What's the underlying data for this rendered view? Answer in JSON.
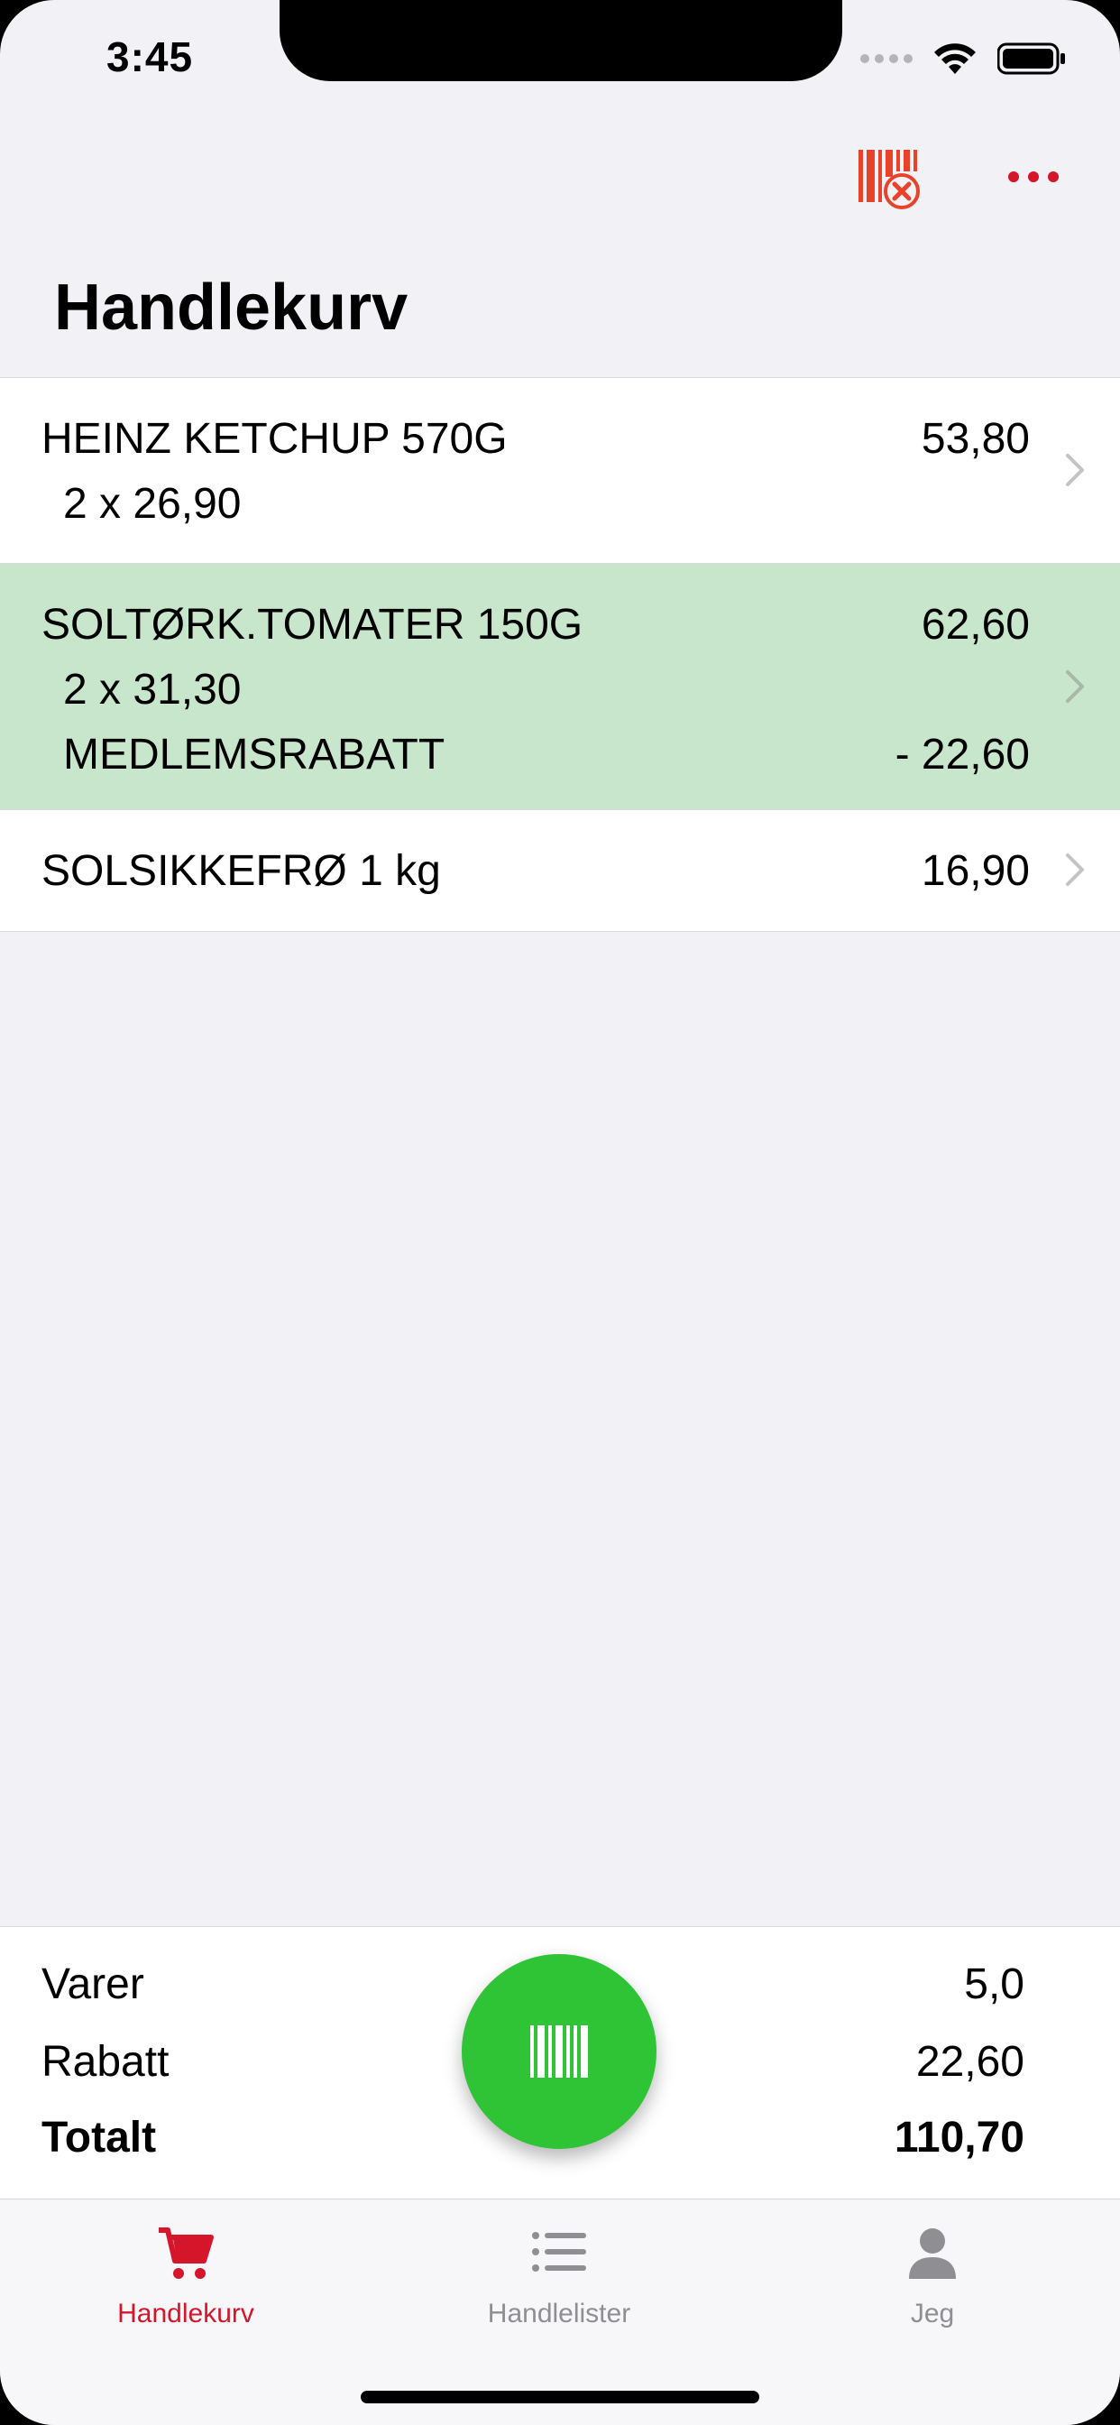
{
  "status_bar": {
    "time": "3:45"
  },
  "header": {
    "title": "Handlekurv"
  },
  "items": [
    {
      "name": "HEINZ KETCHUP 570G",
      "price": "53,80",
      "qty": "2 x  26,90"
    },
    {
      "name": "SOLTØRK.TOMATER 150G",
      "price": "62,60",
      "qty": "2 x  31,30",
      "discount_label": "MEDLEMSRABATT",
      "discount_value": "- 22,60",
      "highlight": "#c8e6cb"
    },
    {
      "name": "SOLSIKKEFRØ 1 kg",
      "price": "16,90"
    }
  ],
  "summary": {
    "items_label": "Varer",
    "items_value": "5,0",
    "discount_label": "Rabatt",
    "discount_value": "22,60",
    "total_label": "Totalt",
    "total_value": "110,70"
  },
  "tabs": [
    {
      "label": "Handlekurv",
      "icon": "cart-icon",
      "active": true
    },
    {
      "label": "Handlelister",
      "icon": "list-icon",
      "active": false
    },
    {
      "label": "Jeg",
      "icon": "person-icon",
      "active": false
    }
  ],
  "colors": {
    "accent": "#d5152a",
    "scan": "#2fc435",
    "inactive": "#8e8e93",
    "barcode_icon": "#e8432a"
  }
}
